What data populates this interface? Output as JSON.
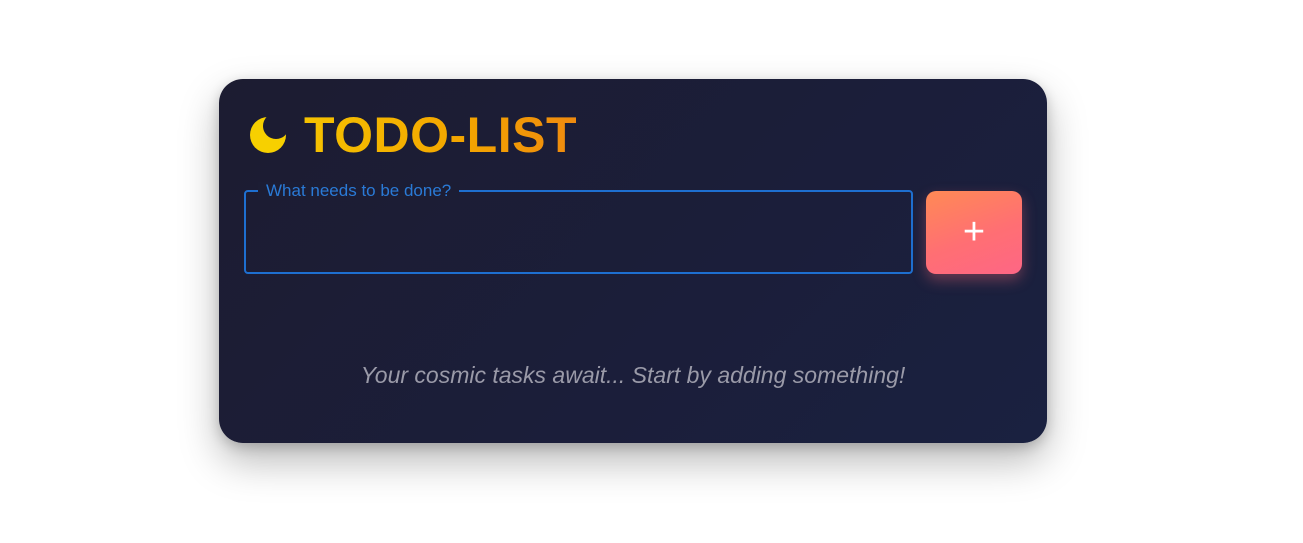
{
  "app": {
    "title": "TODO-LIST",
    "theme_icon": "moon-icon"
  },
  "new_task": {
    "label": "What needs to be done?",
    "value": "",
    "add_button_label": "+",
    "add_button_icon": "plus-icon"
  },
  "task_list": {
    "items": [],
    "empty_message": "Your cosmic tasks await... Start by adding something!"
  },
  "colors": {
    "card_background": "#1b1e3a",
    "title_gradient_start": "#f5c200",
    "title_gradient_end": "#ef8a0f",
    "input_border": "#1e6fd0",
    "add_button_gradient_start": "#ff8a55",
    "add_button_gradient_end": "#fe6685",
    "empty_text": "#9a9aa8"
  }
}
